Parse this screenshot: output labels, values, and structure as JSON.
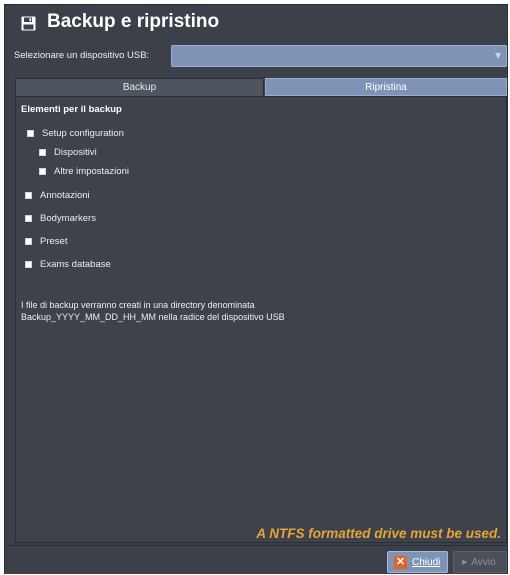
{
  "window": {
    "title": "Backup e ripristino"
  },
  "usb": {
    "label": "Selezionare un dispositivo USB:",
    "selected": ""
  },
  "tabs": [
    {
      "label": "Backup",
      "active": true
    },
    {
      "label": "Ripristina",
      "active": false
    }
  ],
  "backup": {
    "section_title": "Elementi per il backup",
    "items": [
      {
        "label": "Setup configuration",
        "level": 0
      },
      {
        "label": "Dispositivi",
        "level": 1
      },
      {
        "label": "Altre impostazioni",
        "level": 1
      },
      {
        "label": "Annotazioni",
        "level": 0
      },
      {
        "label": "Bodymarkers",
        "level": 0
      },
      {
        "label": "Preset",
        "level": 0
      },
      {
        "label": "Exams database",
        "level": 0
      }
    ],
    "info_line1": "I file di backup verranno creati in una directory denominata",
    "info_line2": "Backup_YYYY_MM_DD_HH_MM nella radice del dispositivo USB"
  },
  "warning": "A NTFS formatted drive must be used.",
  "buttons": {
    "close_label": "Chiudi",
    "start_label": "Avvio"
  },
  "colors": {
    "background": "#3b4049",
    "accent": "#7e93b6",
    "warning": "#e6a43a",
    "close_icon": "#e0632a"
  },
  "icons": {
    "title": "floppy-disk-icon",
    "close": "close-x-icon",
    "start": "play-icon",
    "dropdown": "chevron-down-icon"
  }
}
